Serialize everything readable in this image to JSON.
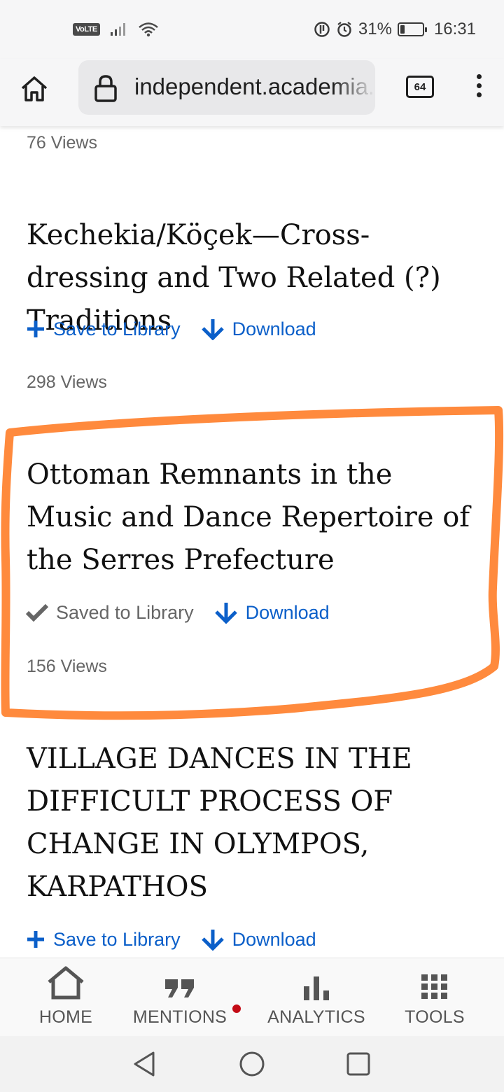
{
  "status_bar": {
    "volte": "VoLTE",
    "battery_percent": "31%",
    "battery_level": 0.31,
    "time": "16:31"
  },
  "browser": {
    "url": "independent.academia.edu",
    "tab_count": "64"
  },
  "papers": [
    {
      "views": "76 Views"
    },
    {
      "title": "Kechekia/Köçek—Cross-dressing and Two Related (?) Traditions",
      "save_label": "Save to Library",
      "download_label": "Download",
      "views": "298 Views"
    },
    {
      "title": "Ottoman Remnants in the Music and Dance Repertoire of the Serres Prefecture",
      "save_label": "Saved to Library",
      "download_label": "Download",
      "views": "156 Views"
    },
    {
      "title": "VILLAGE DANCES IN THE DIFFICULT PROCESS OF CHANGE IN OLYMPOS, KARPATHOS",
      "save_label": "Save to Library",
      "download_label": "Download"
    }
  ],
  "bottom_nav": [
    {
      "label": "HOME",
      "icon": "home-icon"
    },
    {
      "label": "MENTIONS",
      "icon": "quote-icon",
      "has_notification": true
    },
    {
      "label": "ANALYTICS",
      "icon": "bar-chart-icon"
    },
    {
      "label": "TOOLS",
      "icon": "grid-icon"
    }
  ],
  "colors": {
    "link_blue": "#0b5fc9",
    "highlight_orange": "#ff8a3d",
    "notification_red": "#c40c16"
  }
}
